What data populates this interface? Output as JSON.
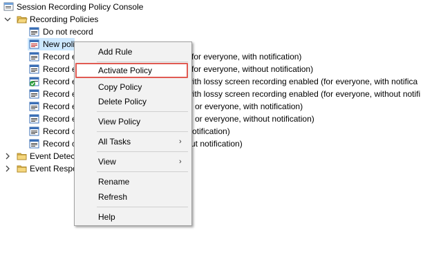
{
  "tree": {
    "root": "Session Recording Policy Console",
    "policies_folder": "Recording Policies",
    "policies": [
      "Do not record",
      "New poli",
      "Record e",
      "Record e",
      "Record e",
      "Record e",
      "Record e",
      "Record e",
      "Record c",
      "Record c"
    ],
    "hidden_right_texts": [
      "",
      "",
      "for everyone, with notification)",
      "for everyone, without notification)",
      "with lossy screen recording enabled (for everyone, with notifica",
      "with lossy screen recording enabled (for everyone, without notifi",
      "or everyone, with notification)",
      "or everyone, without notification)",
      "otification)",
      "ut notification)"
    ],
    "event_detection": "Event Detect",
    "event_response": "Event Respo"
  },
  "menu": {
    "add_rule": "Add Rule",
    "activate_policy": "Activate Policy",
    "copy_policy": "Copy Policy",
    "delete_policy": "Delete Policy",
    "view_policy": "View Policy",
    "all_tasks": "All Tasks",
    "view": "View",
    "rename": "Rename",
    "refresh": "Refresh",
    "help": "Help",
    "submenu_arrow": "›"
  },
  "colors": {
    "highlight_border": "#e05a52",
    "selection": "#cce8ff",
    "menu_bg": "#f2f2f2"
  }
}
